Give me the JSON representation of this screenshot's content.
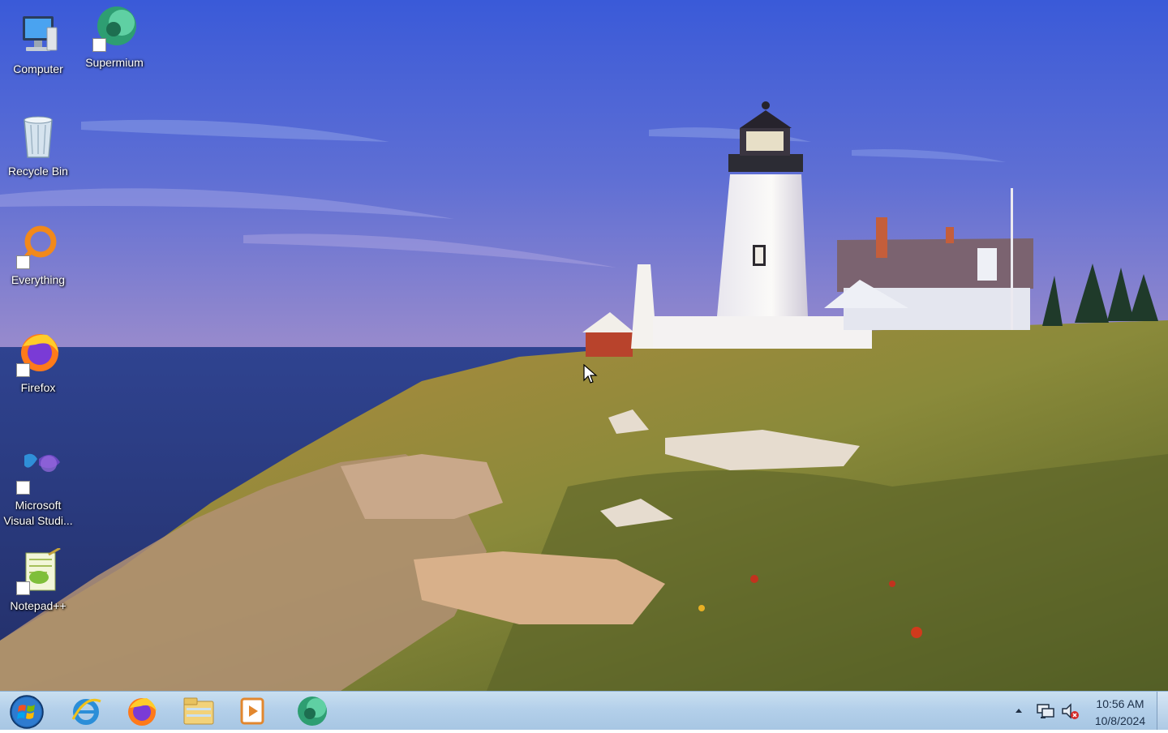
{
  "desktop": {
    "icons": [
      {
        "label": "Computer"
      },
      {
        "label": "Supermium"
      },
      {
        "label": "Recycle Bin"
      },
      {
        "label": "Everything"
      },
      {
        "label": "Firefox"
      },
      {
        "label": "Microsoft Visual Studi..."
      },
      {
        "label": "Notepad++"
      }
    ]
  },
  "taskbar": {
    "pinned": [
      {
        "icon": "internet-explorer-icon"
      },
      {
        "icon": "firefox-icon"
      },
      {
        "icon": "file-explorer-icon"
      },
      {
        "icon": "media-player-icon"
      },
      {
        "icon": "supermium-icon"
      }
    ],
    "clock": {
      "time": "10:56 AM",
      "date": "10/8/2024"
    }
  },
  "colors": {
    "taskbar": "#b4d0ea",
    "sky": "#4a66d8",
    "sea": "#2b3c80"
  }
}
